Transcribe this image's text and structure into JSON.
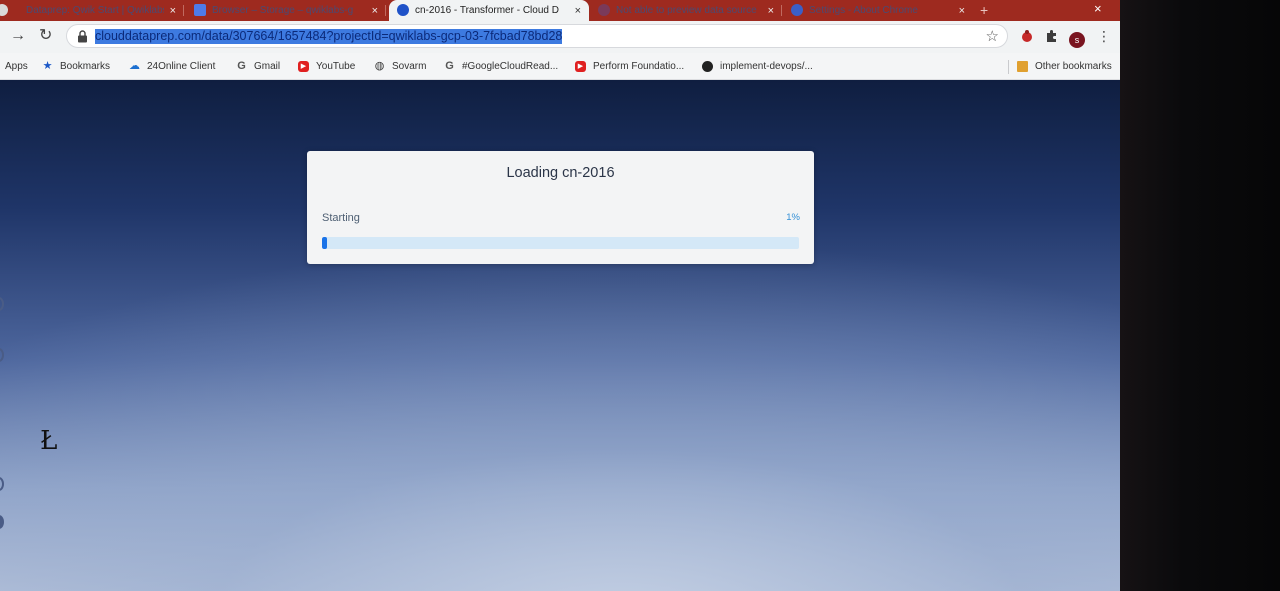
{
  "tabs": [
    {
      "title": "Dataprep: Qwik Start | Qwiklabs",
      "active": false
    },
    {
      "title": "Browser – Storage – qwiklabs-g",
      "active": false
    },
    {
      "title": "cn-2016 - Transformer - Cloud D",
      "active": true
    },
    {
      "title": "Not able to preview data source",
      "active": false
    },
    {
      "title": "Settings - About Chrome",
      "active": false
    }
  ],
  "tab_close_glyph": "×",
  "new_tab_glyph": "+",
  "window_close_glyph": "×",
  "address_bar": {
    "url": "clouddataprep.com/data/307664/1657484?projectId=qwiklabs-gcp-03-7fcbad78bd28"
  },
  "profile_initial": "s",
  "bookmarks": [
    {
      "label": "Apps",
      "icon": "apps-icon"
    },
    {
      "label": "Bookmarks",
      "icon": "star-icon"
    },
    {
      "label": "24Online Client",
      "icon": "cloud-icon"
    },
    {
      "label": "Gmail",
      "icon": "google-icon"
    },
    {
      "label": "YouTube",
      "icon": "youtube-icon"
    },
    {
      "label": "Sovarm",
      "icon": "globe-icon"
    },
    {
      "label": "#GoogleCloudRead...",
      "icon": "google-icon"
    },
    {
      "label": "Perform Foundatio...",
      "icon": "youtube-icon"
    },
    {
      "label": "implement-devops/...",
      "icon": "github-icon"
    }
  ],
  "other_bookmarks": "Other bookmarks",
  "loading_dialog": {
    "title": "Loading cn-2016",
    "status": "Starting",
    "percent_label": "1%",
    "progress": 0.01
  },
  "colors": {
    "tab_strip": "#9e2a1f",
    "url_highlight": "#3d7ae0",
    "progress_fill": "#1a73e8",
    "progress_track": "#d4e8f7",
    "percent_text": "#3390d6"
  }
}
